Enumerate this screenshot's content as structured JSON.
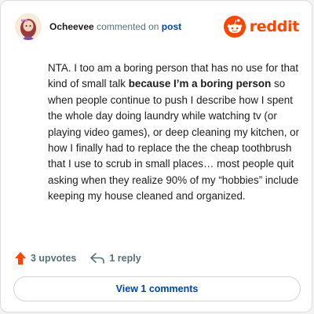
{
  "comment": {
    "username": "Ocheevee",
    "action_text": "commented on",
    "post_link": "post",
    "body_part1": "NTA. I too am a boring person that has no use for that kind of small talk ",
    "body_bold": "because I’m a boring person",
    "body_part2": " so when people continue to push I describe how I spent the whole day doing laundry while watching tv (or playing video games), or deep cleaning my kitchen, or how I finally had to replace the the cheap toothbrush that I use to scrub in small places… most people quit asking when they realize 90% of my “hobbies” include keeping my house cleaned and organized."
  },
  "brand": {
    "name": "reddit",
    "color": "#ff4500"
  },
  "actions": {
    "upvotes_label": "3 upvotes",
    "replies_label": "1 reply",
    "upvote_color": "#ff4500"
  },
  "view_comments_label": "View 1 comments",
  "colors": {
    "link": "#0045ac",
    "meta": "#576f76",
    "text": "#1c1c1c"
  }
}
